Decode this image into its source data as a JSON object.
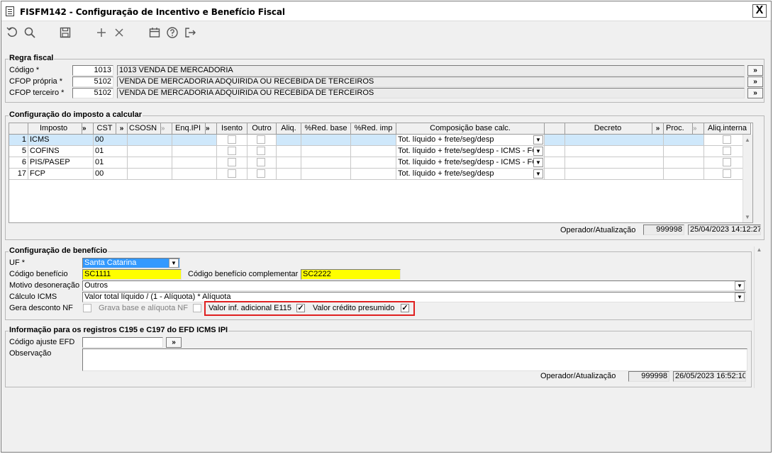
{
  "window": {
    "title": "FISFM142 - Configuração de Incentivo e Benefício Fiscal",
    "close": "X"
  },
  "toolbar": {
    "icons": [
      "undo-icon",
      "search-icon",
      "save-icon",
      "add-icon",
      "delete-icon",
      "calendar-icon",
      "help-icon",
      "exit-icon"
    ]
  },
  "regra": {
    "title": "Regra fiscal",
    "codigo_label": "Código *",
    "codigo_value": "1013",
    "codigo_desc": "1013 VENDA DE MERCADORIA",
    "cfop_propria_label": "CFOP própria *",
    "cfop_propria_value": "5102",
    "cfop_propria_desc": "VENDA DE MERCADORIA ADQUIRIDA OU RECEBIDA DE TERCEIROS",
    "cfop_terceiro_label": "CFOP terceiro *",
    "cfop_terceiro_value": "5102",
    "cfop_terceiro_desc": "VENDA DE MERCADORIA ADQUIRIDA OU RECEBIDA DE TERCEIROS",
    "lookup": "»"
  },
  "imposto": {
    "title": "Configuração do imposto a calcular",
    "headers": {
      "imposto": "Imposto",
      "cst": "CST",
      "csosn": "CSOSN",
      "enq_ipi": "Enq.IPI",
      "isento": "Isento",
      "outro": "Outro",
      "aliq": "Aliq.",
      "red_base": "%Red. base",
      "red_imp": "%Red. imp",
      "composicao": "Composição base calc.",
      "decreto": "Decreto",
      "proc": "Proc.",
      "aliq_interna": "Aliq.interna",
      "btn": "»"
    },
    "rows": [
      {
        "num": "1",
        "imposto": "ICMS",
        "cst": "00",
        "composicao": "Tot. líquido + frete/seg/desp"
      },
      {
        "num": "5",
        "imposto": "COFINS",
        "cst": "01",
        "composicao": "Tot. líquido + frete/seg/desp - ICMS - FC"
      },
      {
        "num": "6",
        "imposto": "PIS/PASEP",
        "cst": "01",
        "composicao": "Tot. líquido + frete/seg/desp - ICMS - FC"
      },
      {
        "num": "17",
        "imposto": "FCP",
        "cst": "00",
        "composicao": "Tot. líquido + frete/seg/desp"
      }
    ],
    "operador_label": "Operador/Atualização",
    "operador": "999998",
    "data": "25/04/2023 14:12:27"
  },
  "beneficio": {
    "title": "Configuração de benefício",
    "uf_label": "UF *",
    "uf_value": "Santa Catarina",
    "cod_label": "Código benefício",
    "cod_value": "SC1111",
    "cod_comp_label": "Código benefício complementar",
    "cod_comp_value": "SC2222",
    "motivo_label": "Motivo desoneração",
    "motivo_value": "Outros",
    "calculo_label": "Cálculo ICMS",
    "calculo_value": "Valor total líquido / (1 - Alíquota) * Alíquota",
    "gera_label": "Gera desconto NF",
    "grava_label": "Grava base e alíquota NF",
    "valor_inf_label": "Valor inf. adicional E115",
    "valor_cred_label": "Valor crédito presumido",
    "check": "✓"
  },
  "efd": {
    "title": "Informação para os registros C195 e C197 do EFD ICMS IPI",
    "ajuste_label": "Código ajuste EFD",
    "ajuste_value": "",
    "obs_label": "Observação",
    "obs_value": "",
    "operador_label": "Operador/Atualização",
    "operador": "999998",
    "data": "26/05/2023 16:52:10"
  }
}
